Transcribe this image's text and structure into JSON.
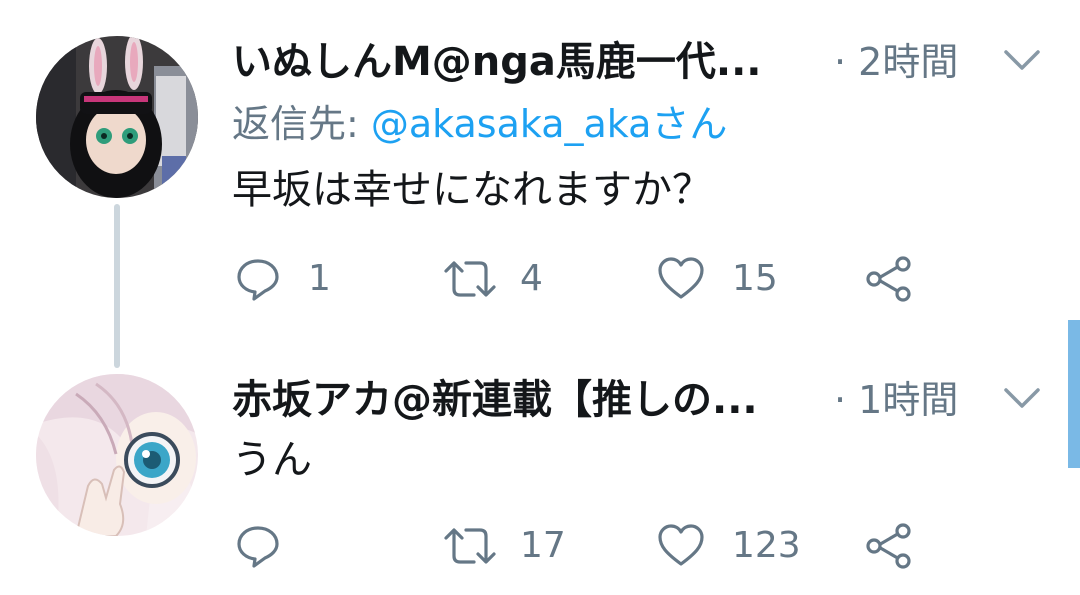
{
  "tweets": [
    {
      "author": "いぬしんM@nga馬鹿一代...",
      "time": "· 2時間",
      "reply_prefix": "返信先: ",
      "reply_handle": "@akasaka_akaさん",
      "text": "早坂は幸せになれますか？",
      "replies": "1",
      "retweets": "4",
      "likes": "15"
    },
    {
      "author": "赤坂アカ@新連載【推しの...",
      "time": "· 1時間",
      "text": "うん",
      "replies": "",
      "retweets": "17",
      "likes": "123"
    }
  ],
  "icons": {
    "reply": "speech-bubble-icon",
    "retweet": "retweet-icon",
    "like": "heart-icon",
    "share": "share-icon",
    "menu": "chevron-down-icon"
  },
  "colors": {
    "text": "#14171a",
    "secondary": "#657786",
    "link": "#1da1f2",
    "thread_line": "#ccd6dd",
    "scrollbar": "#7ab9e6"
  }
}
